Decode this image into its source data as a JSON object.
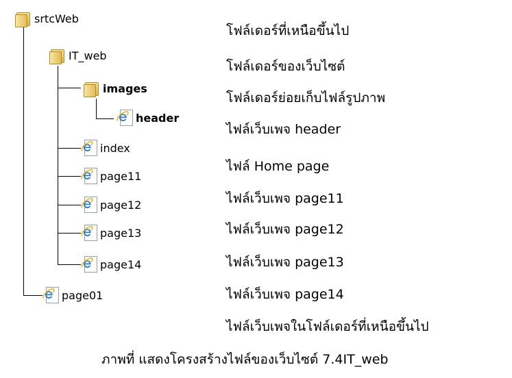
{
  "tree": [
    {
      "name": "srtcWeb",
      "type": "folder"
    },
    {
      "name": "IT_web",
      "type": "folder"
    },
    {
      "name": "images",
      "type": "folder"
    },
    {
      "name": "header",
      "type": "page"
    },
    {
      "name": "index",
      "type": "page"
    },
    {
      "name": "page11",
      "type": "page"
    },
    {
      "name": "page12",
      "type": "page"
    },
    {
      "name": "page13",
      "type": "page"
    },
    {
      "name": "page14",
      "type": "page"
    },
    {
      "name": "page01",
      "type": "page"
    }
  ],
  "descriptions": [
    "โฟล์เดอร์ที่เหนือขึ้นไป",
    "โฟล์เดอร์ของเว็บไซต์",
    "โฟล์เดอร์ย่อยเก็บไฟล์รูปภาพ",
    "ไฟล์เว็บเพจ header",
    "ไฟล์ Home page",
    "ไฟล์เว็บเพจ page11",
    "ไฟล์เว็บเพจ page12",
    "ไฟล์เว็บเพจ page13",
    "ไฟล์เว็บเพจ page14",
    "ไฟล์เว็บเพจในโฟล์เดอร์ที่เหนือขึ้นไป"
  ],
  "caption": "ภาพที่  แสดงโครงสร้างไฟล์ของเว็บไซต์ 7.4IT_web"
}
